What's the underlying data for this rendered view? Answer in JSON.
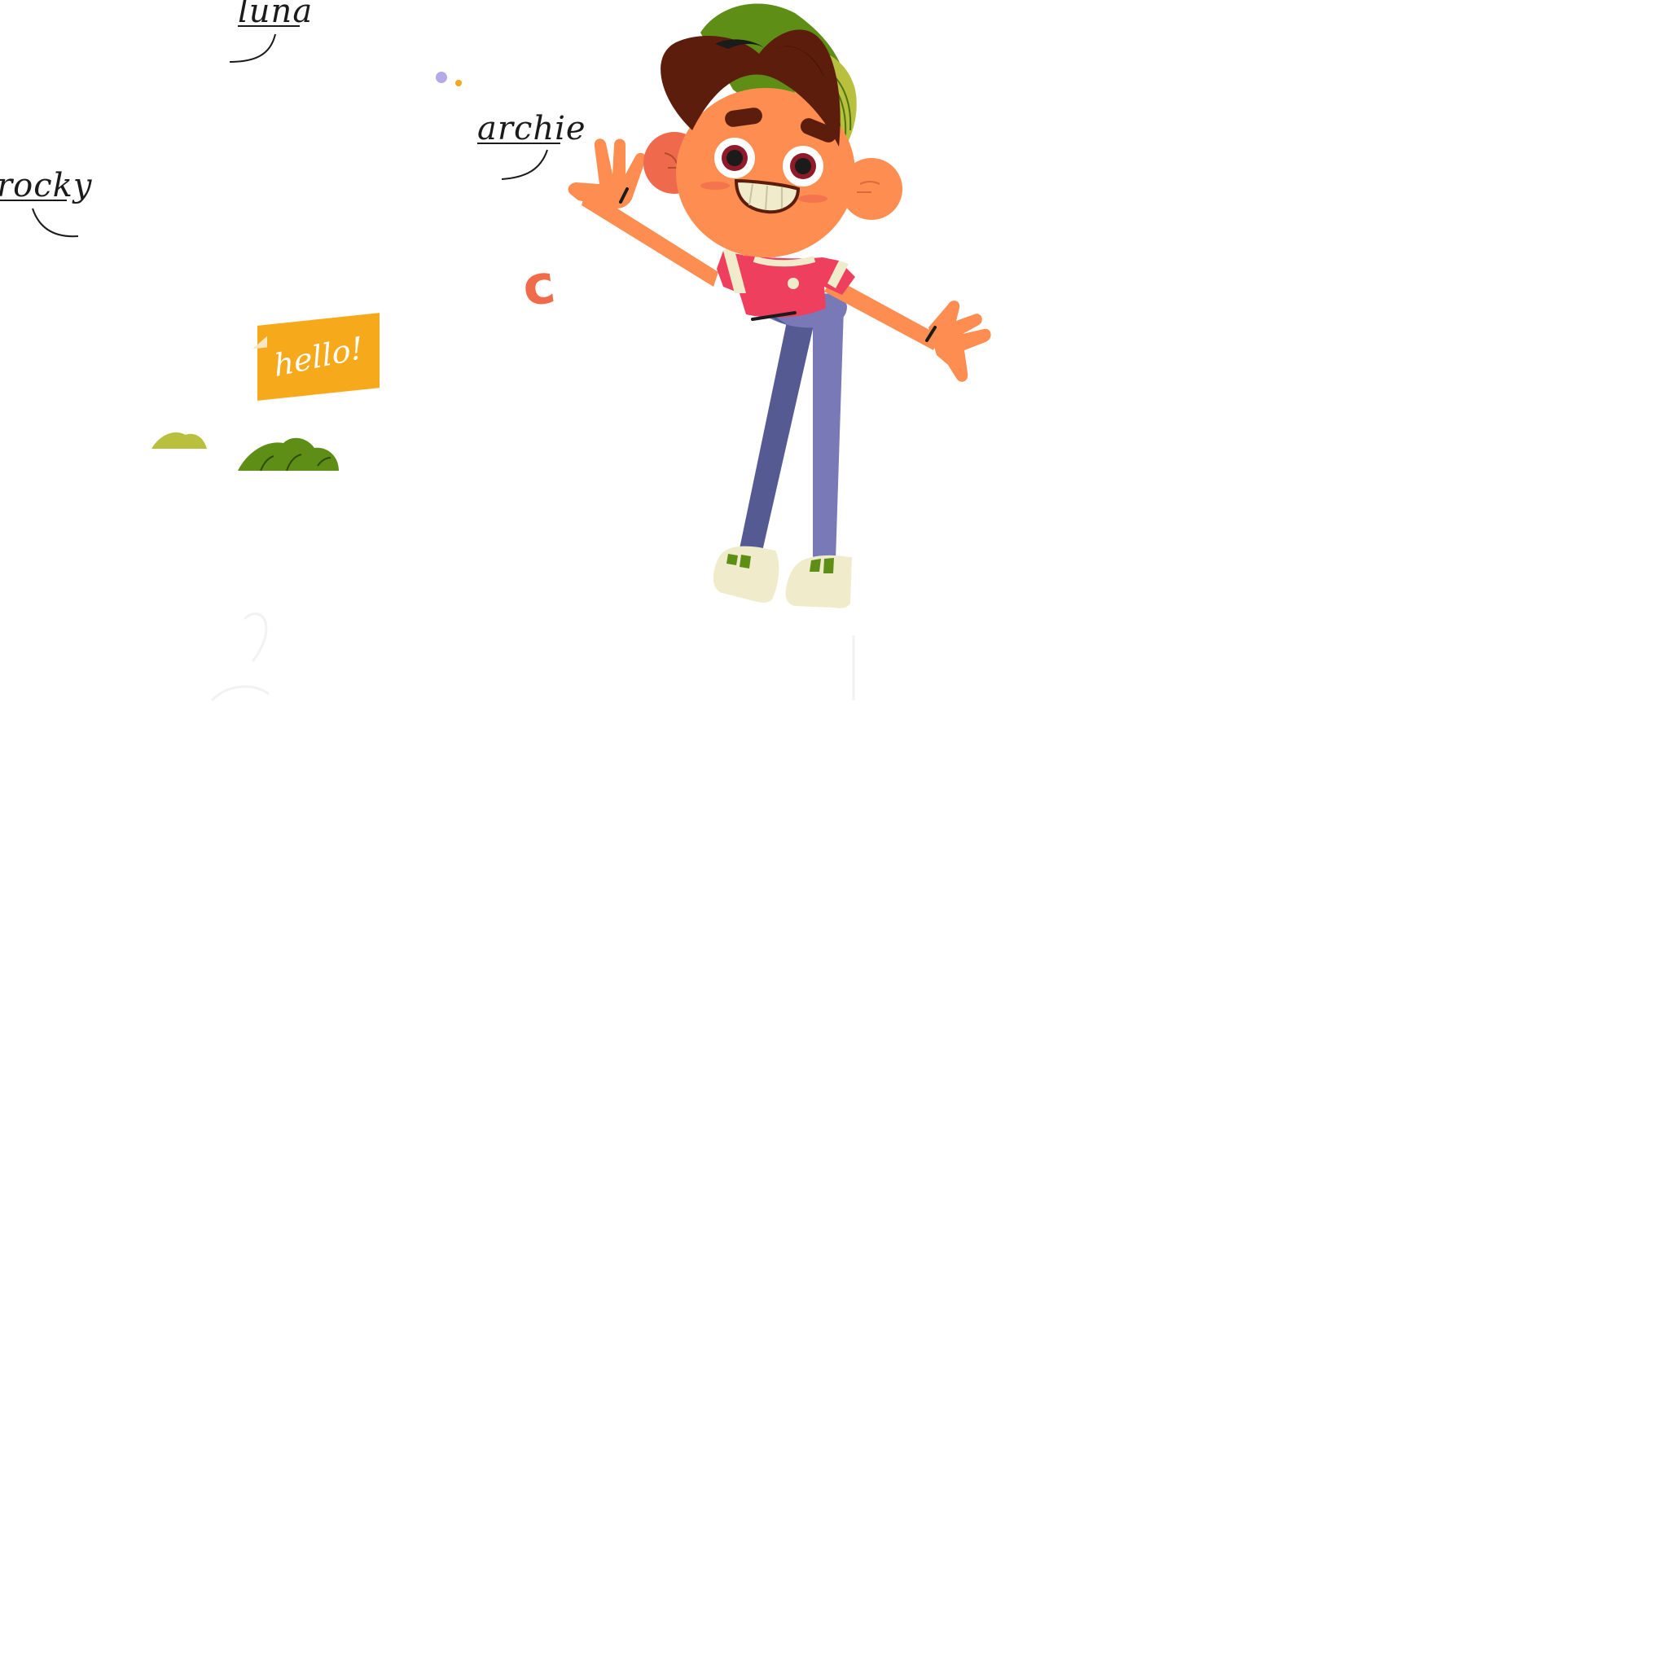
{
  "labels": {
    "luna": "luna",
    "archie": "archie",
    "rocky": "rocky"
  },
  "sticky_note": {
    "text": "hello!"
  },
  "decor_letter": "c",
  "colors": {
    "skin": "#fd8d50",
    "hair": "#5c1d0d",
    "cap_green": "#5e8e15",
    "cap_light": "#b8c03e",
    "shirt": "#ee3f5f",
    "pants_dark": "#555a92",
    "pants_light": "#7a79b8",
    "shoes": "#f0eccb",
    "note": "#f6a91a",
    "letter": "#f06b4a",
    "dot_purple": "#b5a9e6",
    "dot_orange": "#f5a623"
  },
  "icons": [
    "cartoon-boy-illustration",
    "bush-icon",
    "dot-icon"
  ]
}
